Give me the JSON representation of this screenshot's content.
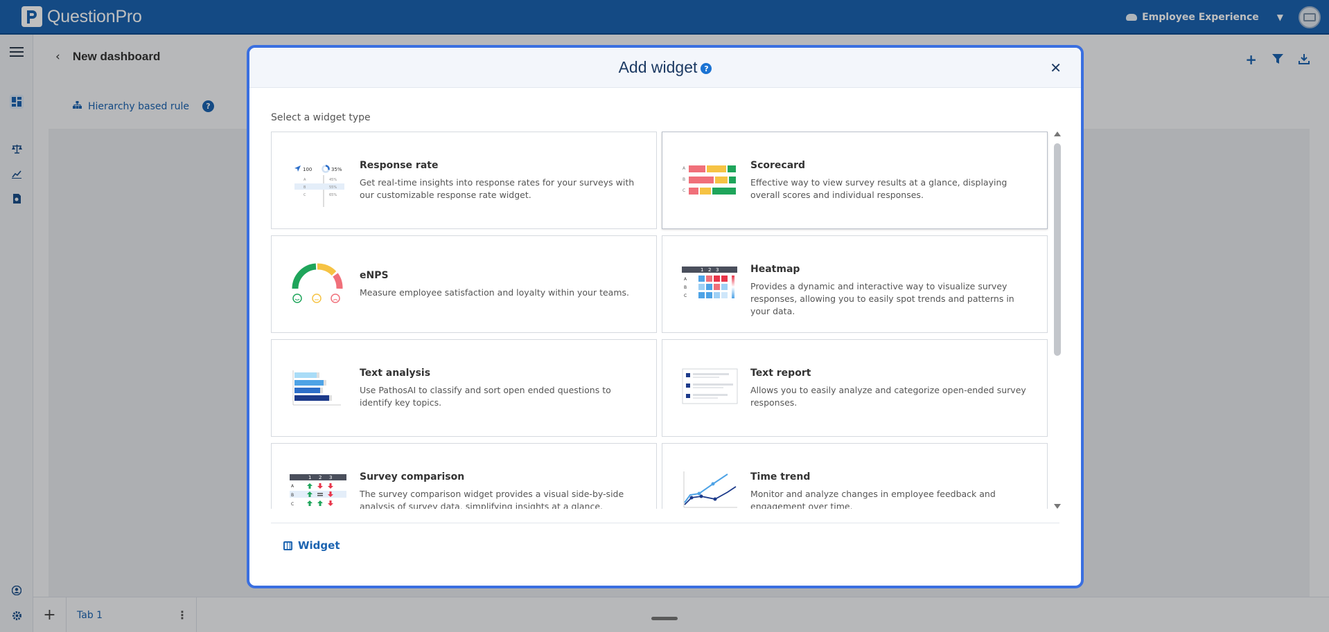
{
  "topbar": {
    "logo_text": "QuestionPro",
    "product_name": "Employee Experience",
    "product_caret": "▼"
  },
  "dashboard": {
    "title": "New dashboard",
    "rule_label": "Hierarchy based rule",
    "help": "?"
  },
  "tabs": {
    "add": "+",
    "items": [
      {
        "label": "Tab 1"
      }
    ],
    "kebab": "⋮"
  },
  "modal": {
    "title": "Add widget",
    "help": "?",
    "close": "✕",
    "select_label": "Select a widget type",
    "footer_link": "Widget",
    "widgets": [
      {
        "name": "Response rate",
        "description": "Get real-time insights into response rates for your surveys with our customizable response rate widget."
      },
      {
        "name": "Scorecard",
        "description": "Effective way to view survey results at a glance, displaying overall scores and individual responses."
      },
      {
        "name": "eNPS",
        "description": "Measure employee satisfaction and loyalty within your teams."
      },
      {
        "name": "Heatmap",
        "description": "Provides a dynamic and interactive way to visualize survey responses, allowing you to easily spot trends and patterns in your data."
      },
      {
        "name": "Text analysis",
        "description": "Use PathosAI to classify and sort open ended questions to identify key topics."
      },
      {
        "name": "Text report",
        "description": "Allows you to easily analyze and categorize open-ended survey responses."
      },
      {
        "name": "Survey comparison",
        "description": "The survey comparison widget provides a visual side-by-side analysis of survey data, simplifying insights at a glance."
      },
      {
        "name": "Time trend",
        "description": "Monitor and analyze changes in employee feedback and engagement over time."
      }
    ],
    "illustration_text": {
      "response_rate": {
        "count": "100",
        "percent": "35%",
        "rows": [
          "A",
          "B",
          "C"
        ],
        "row_values": [
          "45%",
          "55%",
          "65%"
        ]
      },
      "row_letters": [
        "A",
        "B",
        "C"
      ],
      "column_numbers": [
        "1",
        "2",
        "3"
      ]
    }
  },
  "colors": {
    "brand": "#1b63b0",
    "modal_border": "#3a6fe0",
    "green": "#1fa55b",
    "yellow": "#f6c344",
    "red": "#f0707a"
  }
}
